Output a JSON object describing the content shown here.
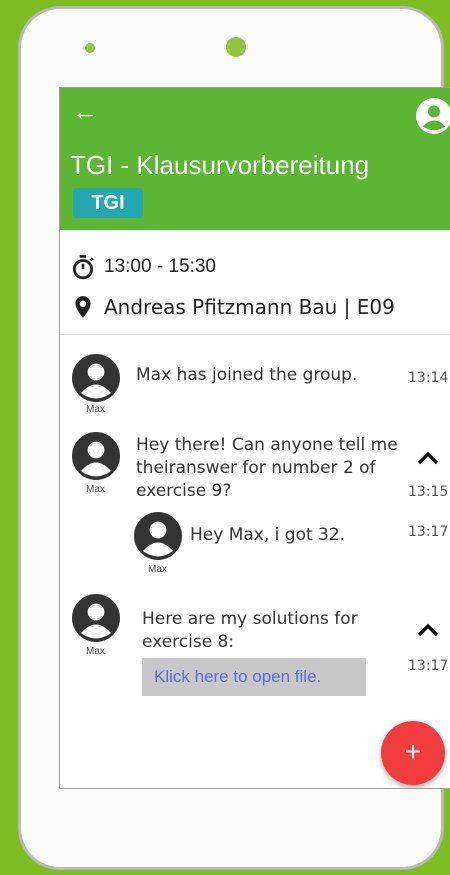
{
  "group": {
    "title": "TGI - Klausurvorbereitung",
    "badge": "TGI"
  },
  "event": {
    "time": "13:00 - 15:30",
    "location": "Andreas Pfitzmann Bau | E09"
  },
  "messages": [
    {
      "author": "Max",
      "text": "Max has joined the group.",
      "time": "13:14"
    },
    {
      "author": "Max",
      "text": "Hey there! Can anyone tell me theiranswer for number 2 of exercise 9?",
      "time": "13:15"
    },
    {
      "author": "Max",
      "text": "Hey Max, i got 32.",
      "time": "13:17"
    },
    {
      "author": "Max",
      "text": "Here are my solutions for exercise 8:",
      "time": "13:17",
      "file_link": "Klick here to open file."
    }
  ],
  "fab_label": "+",
  "colors": {
    "appbar": "#5cb533",
    "badge": "#23a8b0",
    "fab": "#f03c3c",
    "background": "#7dbd1f"
  },
  "icons": [
    "back-arrow-icon",
    "account-circle-icon",
    "stopwatch-icon",
    "location-pin-icon",
    "chevron-up-icon",
    "add-icon"
  ]
}
